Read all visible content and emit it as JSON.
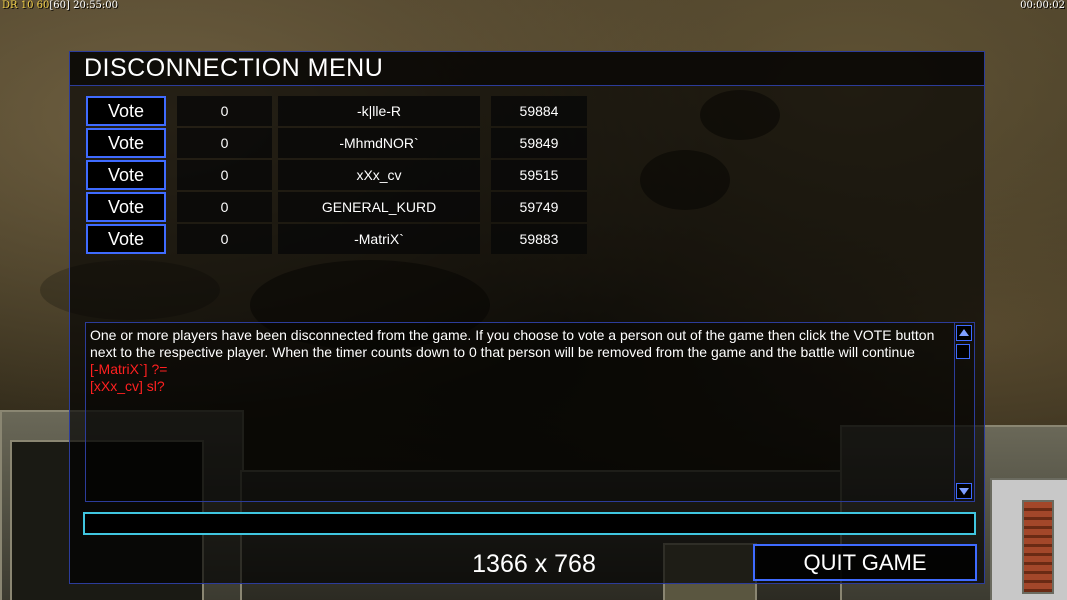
{
  "status": {
    "fps_prefix": "DR",
    "fps_values": "10 60",
    "fps_bracket": "[60]",
    "clock": "20:55:00",
    "game_timer": "00:00:02"
  },
  "menu": {
    "title": "DISCONNECTION MENU",
    "players": [
      {
        "vote_label": "Vote",
        "votes": "0",
        "name": "-k|lle-R",
        "timer": "59884"
      },
      {
        "vote_label": "Vote",
        "votes": "0",
        "name": "-MhmdNOR`",
        "timer": "59849"
      },
      {
        "vote_label": "Vote",
        "votes": "0",
        "name": "xXx_cv",
        "timer": "59515"
      },
      {
        "vote_label": "Vote",
        "votes": "0",
        "name": "GENERAL_KURD",
        "timer": "59749"
      },
      {
        "vote_label": "Vote",
        "votes": "0",
        "name": "-MatriX`",
        "timer": "59883"
      }
    ],
    "chat": {
      "system_message": "One or more players have been disconnected from the game. If you choose to vote a person out of the game then click the VOTE button next to the respective player. When the timer counts down to 0 that person will be removed from the game and the battle will continue",
      "messages": [
        {
          "text": "[-MatriX`] ?=",
          "color": "#ff2020"
        },
        {
          "text": "[xXx_cv] sl?",
          "color": "#ff2020"
        }
      ]
    },
    "chat_input_value": "",
    "quit_label": "QUIT GAME",
    "resolution": "1366 x 768"
  },
  "colors": {
    "border_blue": "#3f6bff",
    "input_cyan": "#40c6e0",
    "chat_red": "#ff2020"
  }
}
